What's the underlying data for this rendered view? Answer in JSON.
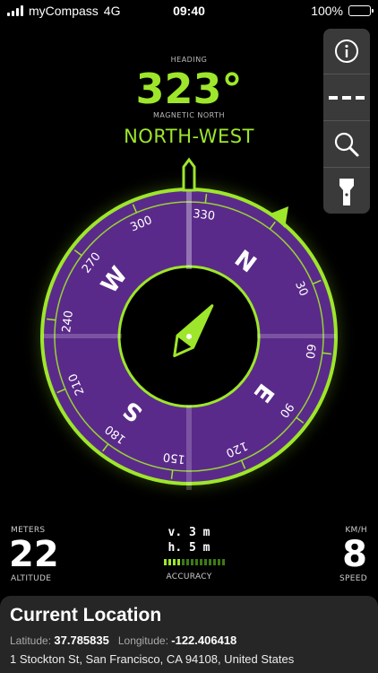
{
  "status_bar": {
    "carrier": "myCompass",
    "network": "4G",
    "time": "09:40",
    "battery": "100%"
  },
  "heading": {
    "label": "HEADING",
    "value": "323°",
    "reference": "MAGNETIC NORTH",
    "direction": "NORTH-WEST"
  },
  "toolbar": {
    "icons": [
      "info-icon",
      "dash-icon",
      "search-icon",
      "flashlight-icon"
    ]
  },
  "compass": {
    "heading_degrees": 323,
    "cardinals": [
      "N",
      "E",
      "S",
      "W"
    ],
    "degree_labels": [
      "30",
      "60",
      "90",
      "120",
      "150",
      "180",
      "210",
      "240",
      "270",
      "300",
      "330"
    ],
    "colors": {
      "accent": "#9ee62b",
      "dial": "#5a2a8a"
    }
  },
  "altitude": {
    "unit": "METERS",
    "value": "22",
    "label": "ALTITUDE"
  },
  "accuracy": {
    "vertical": "v. 3 m",
    "horizontal": "h. 5 m",
    "label": "ACCURACY",
    "level": 0.25
  },
  "speed": {
    "unit": "KM/H",
    "value": "8",
    "label": "SPEED"
  },
  "location": {
    "title": "Current Location",
    "latitude_label": "Latitude:",
    "latitude": "37.785835",
    "longitude_label": "Longitude:",
    "longitude": "-122.406418",
    "address": "1 Stockton St, San Francisco, CA  94108, United States"
  }
}
